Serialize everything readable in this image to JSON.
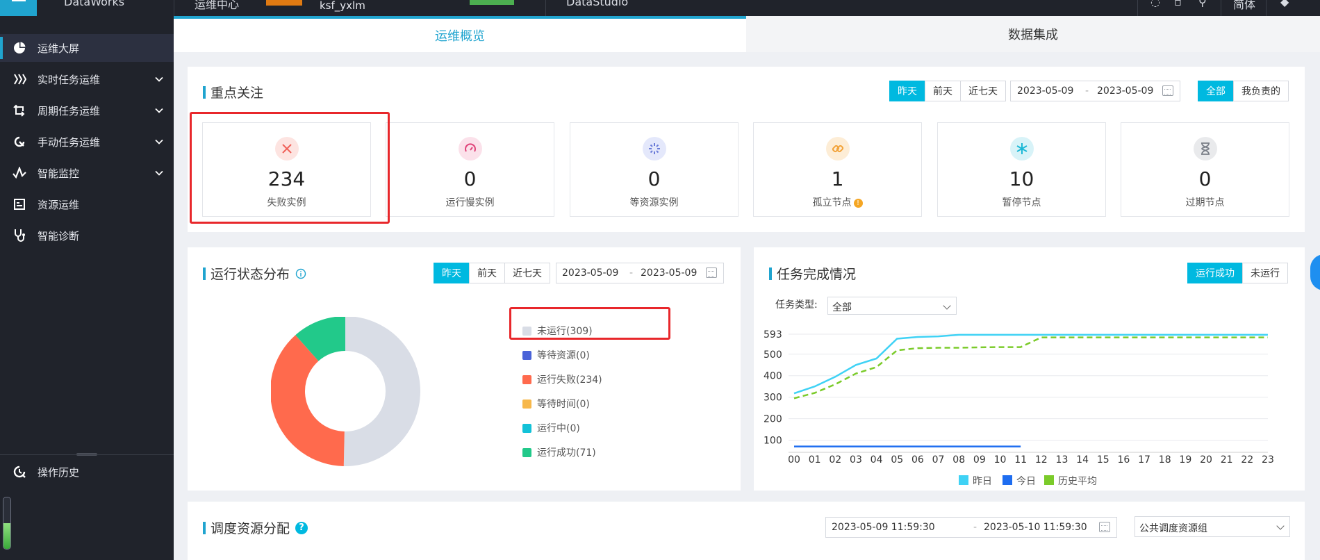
{
  "topbar": {
    "logo": "DataWorks",
    "module": "运维中心",
    "project": "ksf_yxlm",
    "badge": "",
    "studio": "DataStudio",
    "lang": "简体"
  },
  "sidebar": {
    "items": [
      {
        "label": "运维大屏",
        "icon": "pie-chart-icon",
        "active": true,
        "expandable": false
      },
      {
        "label": "实时任务运维",
        "icon": "stream-icon",
        "active": false,
        "expandable": true
      },
      {
        "label": "周期任务运维",
        "icon": "cycle-icon",
        "active": false,
        "expandable": true
      },
      {
        "label": "手动任务运维",
        "icon": "manual-icon",
        "active": false,
        "expandable": true
      },
      {
        "label": "智能监控",
        "icon": "monitor-icon",
        "active": false,
        "expandable": true
      },
      {
        "label": "资源运维",
        "icon": "resource-icon",
        "active": false,
        "expandable": false
      },
      {
        "label": "智能诊断",
        "icon": "stethoscope-icon",
        "active": false,
        "expandable": false
      }
    ],
    "history": {
      "label": "操作历史",
      "icon": "history-icon"
    },
    "gauge_fraction": 0.5
  },
  "tabs": [
    {
      "label": "运维概览",
      "active": true
    },
    {
      "label": "数据集成",
      "active": false
    }
  ],
  "focus": {
    "title": "重点关注",
    "range_buttons": [
      "昨天",
      "前天",
      "近七天"
    ],
    "date_start": "2023-05-09",
    "date_end": "2023-05-09",
    "date_sep": "-",
    "owner_buttons": [
      "全部",
      "我负责的"
    ],
    "cards": [
      {
        "value": "234",
        "label": "失败实例",
        "icon": "fail-x-icon",
        "color": "#f0625a",
        "bg": "#fde4e1"
      },
      {
        "value": "0",
        "label": "运行慢实例",
        "icon": "speed-gauge-icon",
        "color": "#e0447a",
        "bg": "#fbe1ea"
      },
      {
        "value": "0",
        "label": "等资源实例",
        "icon": "loading-icon",
        "color": "#6a7bd8",
        "bg": "#e4e8fb"
      },
      {
        "value": "1",
        "label": "孤立节点",
        "icon": "isolated-link-icon",
        "color": "#f2a33a",
        "bg": "#fdedd6",
        "info": "!"
      },
      {
        "value": "10",
        "label": "暂停节点",
        "icon": "snowflake-icon",
        "color": "#1cb8d6",
        "bg": "#d8f3f8"
      },
      {
        "value": "0",
        "label": "过期节点",
        "icon": "hourglass-icon",
        "color": "#7a7f88",
        "bg": "#e9eaec"
      }
    ]
  },
  "status": {
    "title": "运行状态分布",
    "range_buttons": [
      "昨天",
      "前天",
      "近七天"
    ],
    "date_start": "2023-05-09",
    "date_end": "2023-05-09",
    "date_sep": "-",
    "legend": [
      {
        "label": "未运行(309)",
        "color": "#d9dde6"
      },
      {
        "label": "等待资源(0)",
        "color": "#4a63d8"
      },
      {
        "label": "运行失败(234)",
        "color": "#ff6a4d"
      },
      {
        "label": "等待时间(0)",
        "color": "#f7b84b"
      },
      {
        "label": "运行中(0)",
        "color": "#13c2d8"
      },
      {
        "label": "运行成功(71)",
        "color": "#22c98a"
      }
    ]
  },
  "completion": {
    "title": "任务完成情况",
    "buttons": [
      "运行成功",
      "未运行"
    ],
    "type_label": "任务类型:",
    "type_value": "全部",
    "legend": [
      {
        "label": "昨日",
        "color": "#3fd2f5"
      },
      {
        "label": "今日",
        "color": "#1e6df0"
      },
      {
        "label": "历史平均",
        "color": "#7bcb2a"
      }
    ]
  },
  "resource": {
    "title": "调度资源分配",
    "help": "?",
    "date_start": "2023-05-09 11:59:30",
    "date_end": "2023-05-10 11:59:30",
    "date_sep": "-",
    "group": "公共调度资源组"
  },
  "chart_data": [
    {
      "type": "pie",
      "title": "运行状态分布",
      "categories": [
        "未运行",
        "等待资源",
        "运行失败",
        "等待时间",
        "运行中",
        "运行成功"
      ],
      "values": [
        309,
        0,
        234,
        0,
        0,
        71
      ],
      "colors": [
        "#d9dde6",
        "#4a63d8",
        "#ff6a4d",
        "#f7b84b",
        "#13c2d8",
        "#22c98a"
      ],
      "donut": true
    },
    {
      "type": "line",
      "title": "任务完成情况",
      "x": [
        "00",
        "01",
        "02",
        "03",
        "04",
        "05",
        "06",
        "07",
        "08",
        "09",
        "10",
        "11",
        "12",
        "13",
        "14",
        "15",
        "16",
        "17",
        "18",
        "19",
        "20",
        "21",
        "22",
        "23"
      ],
      "yticks": [
        100,
        200,
        300,
        400,
        500,
        593
      ],
      "ylim": [
        60,
        593
      ],
      "grid": true,
      "legend_position": "bottom",
      "series": [
        {
          "name": "昨日",
          "color": "#3fd2f5",
          "dash": false,
          "values": [
            318,
            350,
            395,
            450,
            480,
            572,
            580,
            583,
            590,
            590,
            590,
            590,
            590,
            590,
            590,
            590,
            590,
            590,
            590,
            590,
            590,
            590,
            590,
            590
          ]
        },
        {
          "name": "今日",
          "color": "#1e6df0",
          "dash": false,
          "values": [
            71,
            71,
            71,
            71,
            71,
            71,
            71,
            71,
            71,
            71,
            71,
            71
          ]
        },
        {
          "name": "历史平均",
          "color": "#7bcb2a",
          "dash": true,
          "values": [
            295,
            320,
            360,
            410,
            440,
            518,
            528,
            530,
            530,
            532,
            533,
            533,
            578,
            578,
            578,
            578,
            578,
            578,
            578,
            578,
            578,
            578,
            578,
            578
          ]
        }
      ]
    }
  ]
}
